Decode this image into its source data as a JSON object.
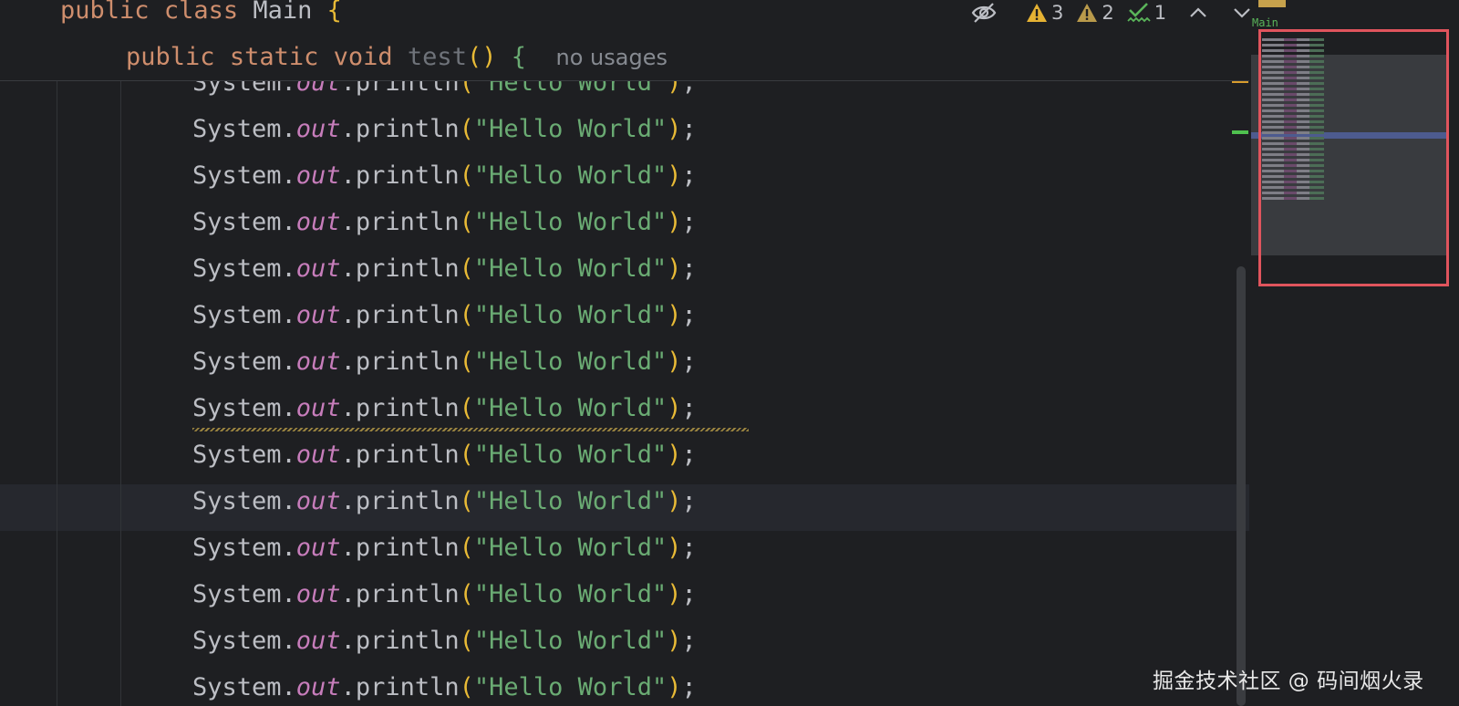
{
  "sticky_header": {
    "class_line": {
      "kw1": "public",
      "kw2": "class",
      "name": "Main",
      "brace": "{"
    },
    "method_line": {
      "kw1": "public",
      "kw2": "static",
      "kw3": "void",
      "name": "test",
      "parens": "()",
      "brace": "{",
      "hint": "no usages"
    }
  },
  "code": {
    "lines": [
      {
        "obj": "System.",
        "field": "out",
        "call": ".println",
        "open": "(",
        "str": "\"Hello World\"",
        "close": ")",
        "semi": ";"
      },
      {
        "obj": "System.",
        "field": "out",
        "call": ".println",
        "open": "(",
        "str": "\"Hello World\"",
        "close": ")",
        "semi": ";"
      },
      {
        "obj": "System.",
        "field": "out",
        "call": ".println",
        "open": "(",
        "str": "\"Hello World\"",
        "close": ")",
        "semi": ";"
      },
      {
        "obj": "System.",
        "field": "out",
        "call": ".println",
        "open": "(",
        "str": "\"Hello World\"",
        "close": ")",
        "semi": ";"
      },
      {
        "obj": "System.",
        "field": "out",
        "call": ".println",
        "open": "(",
        "str": "\"Hello World\"",
        "close": ")",
        "semi": ";"
      },
      {
        "obj": "System.",
        "field": "out",
        "call": ".println",
        "open": "(",
        "str": "\"Hello World\"",
        "close": ")",
        "semi": ";"
      },
      {
        "obj": "System.",
        "field": "out",
        "call": ".println",
        "open": "(",
        "str": "\"Hello World\"",
        "close": ")",
        "semi": ";"
      },
      {
        "obj": "System.",
        "field": "out",
        "call": ".println",
        "open": "(",
        "str": "\"Hello World\"",
        "close": ")",
        "semi": ";"
      },
      {
        "obj": "System.",
        "field": "out",
        "call": ".println",
        "open": "(",
        "str": "\"Hello World\"",
        "close": ")",
        "semi": ";"
      },
      {
        "obj": "System.",
        "field": "out",
        "call": ".println",
        "open": "(",
        "str": "\"Hello World\"",
        "close": ")",
        "semi": ";"
      },
      {
        "obj": "System.",
        "field": "out",
        "call": ".println",
        "open": "(",
        "str": "\"Hello World\"",
        "close": ")",
        "semi": ";"
      },
      {
        "obj": "System.",
        "field": "out",
        "call": ".println",
        "open": "(",
        "str": "\"Hello World\"",
        "close": ")",
        "semi": ";"
      },
      {
        "obj": "System.",
        "field": "out",
        "call": ".println",
        "open": "(",
        "str": "\"Hello World\"",
        "close": ")",
        "semi": ";"
      },
      {
        "obj": "System.",
        "field": "out",
        "call": ".println",
        "open": "(",
        "str": "\"Hello World\"",
        "close": ")",
        "semi": ";"
      }
    ]
  },
  "inspections": {
    "warnings": "3",
    "weak_warnings": "2",
    "typos": "1",
    "icons": [
      "eye-slash-icon",
      "warning-icon",
      "weak-warning-icon",
      "typo-check-icon",
      "chevron-up-icon",
      "chevron-down-icon"
    ]
  },
  "minimap": {
    "title": "Main"
  },
  "watermark": "掘金技术社区 @ 码间烟火录",
  "colors": {
    "keyword": "#cf8e6d",
    "string": "#6aab73",
    "field": "#c77dbb",
    "paren": "#e8ba36",
    "highlight_box": "#e0545d"
  }
}
